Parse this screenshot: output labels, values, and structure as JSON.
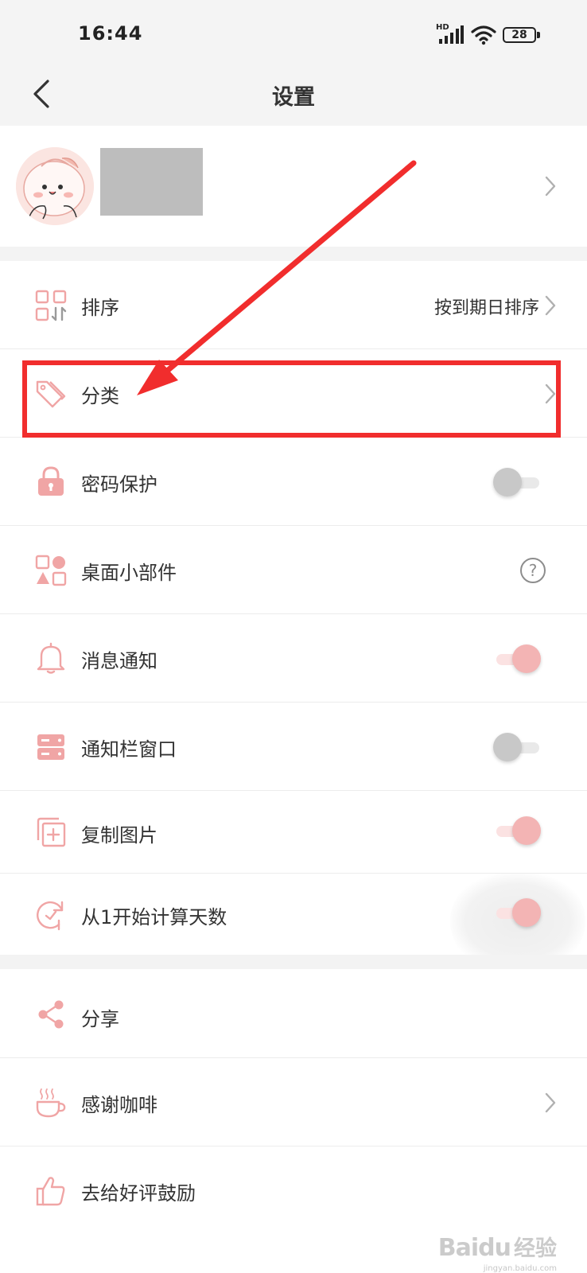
{
  "status_bar": {
    "time": "16:44",
    "network": "HD",
    "battery": "28"
  },
  "header": {
    "title": "设置"
  },
  "settings": {
    "sort": {
      "label": "排序",
      "value": "按到期日排序"
    },
    "category": {
      "label": "分类"
    },
    "password": {
      "label": "密码保护",
      "toggle": false
    },
    "widget": {
      "label": "桌面小部件",
      "help": "?"
    },
    "notify": {
      "label": "消息通知",
      "toggle": true
    },
    "notify_bar": {
      "label": "通知栏窗口",
      "toggle": false
    },
    "copy_image": {
      "label": "复制图片",
      "toggle": true
    },
    "count_from_one": {
      "label": "从1开始计算天数",
      "toggle": true
    },
    "share": {
      "label": "分享"
    },
    "coffee": {
      "label": "感谢咖啡"
    },
    "rate": {
      "label": "去给好评鼓励"
    }
  },
  "watermark": {
    "logo": "Baidu",
    "text": "经验",
    "url": "jingyan.baidu.com"
  },
  "colors": {
    "accent": "#f0a5a5",
    "annotation": "#f12d2d",
    "background": "#f3f3f3"
  }
}
